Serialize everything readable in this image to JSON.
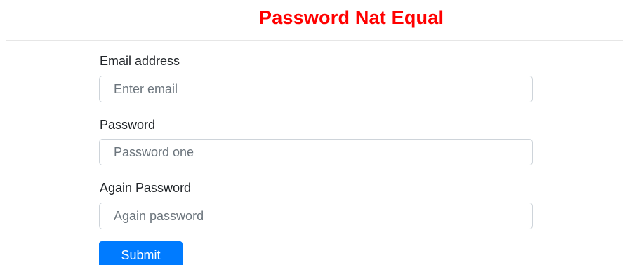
{
  "header": {
    "title": "Password Nat Equal",
    "title_color": "#ff0000"
  },
  "form": {
    "email": {
      "label": "Email address",
      "placeholder": "Enter email",
      "value": ""
    },
    "password": {
      "label": "Password",
      "placeholder": "Password one",
      "value": ""
    },
    "again_password": {
      "label": "Again Password",
      "placeholder": "Again password",
      "value": ""
    },
    "submit_label": "Submit",
    "submit_color": "#007bff"
  }
}
